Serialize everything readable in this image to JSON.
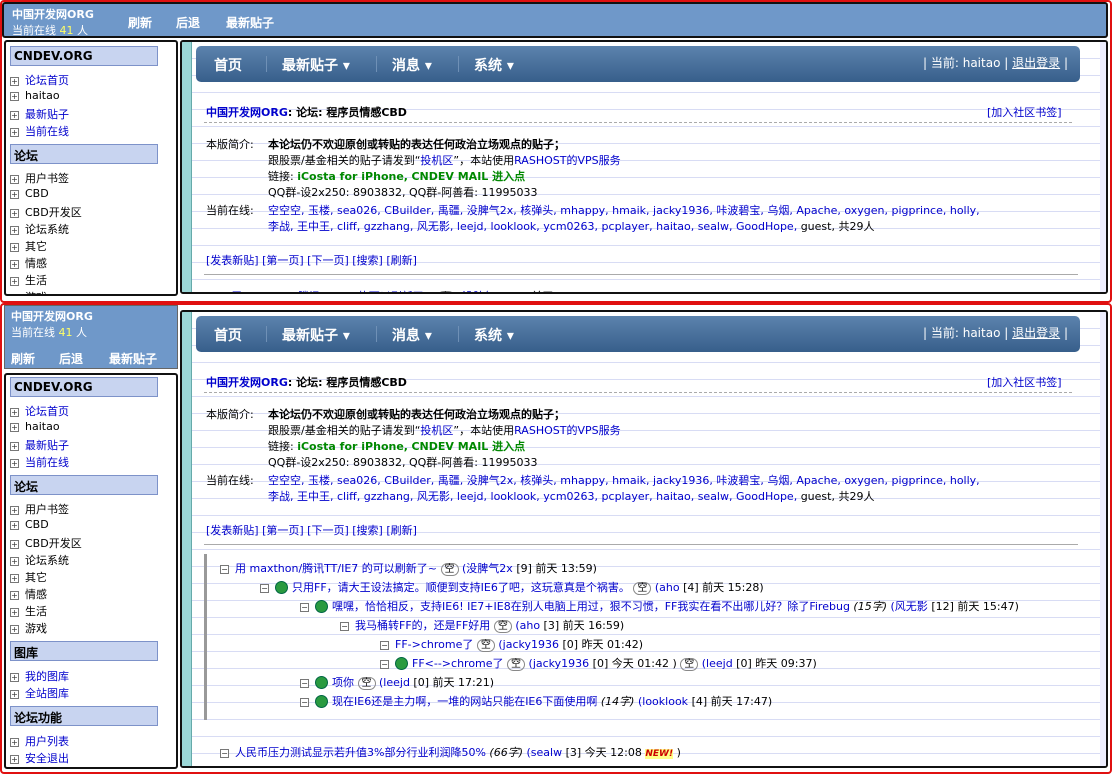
{
  "header": {
    "site": "中国开发网ORG",
    "online_label": "当前在线",
    "online_count": "41",
    "online_unit": "人",
    "buttons": [
      "刷新",
      "后退",
      "最新贴子"
    ]
  },
  "sidebar": {
    "brand": "CNDEV.ORG",
    "top_items": [
      "论坛首页",
      "haitao",
      "最新贴子",
      "当前在线"
    ],
    "sections": [
      {
        "title": "论坛",
        "items": [
          "用户书签",
          "CBD",
          "CBD开发区",
          "论坛系统",
          "其它",
          "情感",
          "生活",
          "游戏"
        ]
      },
      {
        "title": "图库",
        "items": [
          "我的图库",
          "全站图库"
        ]
      },
      {
        "title": "论坛功能",
        "items": [
          "用户列表",
          "安全退出"
        ]
      }
    ]
  },
  "nav": {
    "items": [
      "首页",
      "最新贴子 ▾",
      "消息 ▾",
      "系统 ▾"
    ],
    "current_label": "| 当前: haitao |",
    "logout": "退出登录",
    "end_sep": "|"
  },
  "forum": {
    "site": "中国开发网ORG",
    "crumb_rest": ": 论坛: 程序员情感CBD",
    "bookmark": "[加入社区书签]",
    "intro_label": "本版简介:",
    "intro_line1": "本论坛仍不欢迎原创或转贴的表达任何政治立场观点的贴子；",
    "intro_line2_a": "跟股票/基金相关的贴子请发到“",
    "intro_line2_link": "投机区",
    "intro_line2_b": "”，本站使用",
    "intro_line2_link2": "RASHOST的VPS服务",
    "links_label": "链接:",
    "link1": "iCosta for iPhone,",
    "link2": "CNDEV MAIL 进入点",
    "qq_line": "QQ群-设2x250: 8903832, QQ群-阿善看: 11995033",
    "online_label": "当前在线:",
    "online_users_1": "空空空, 玉楼, sea026, CBuilder, 禹疆, 没脾气2x, 核弹头, mhappy, hmaik, jacky1936, 咔波碧宝, 乌烟, Apache, oxygen, pigprince, holly,",
    "online_users_2": "李战, 王中王, cliff, gzzhang, 风无影, leejd, looklook, ycm0263, pcplayer, haitao, sealw, GoodHope,",
    "guest_total": "guest, 共29人",
    "actions": "[发表新贴] [第一页] [下一页] [搜索] [刷新]"
  },
  "threads": [
    {
      "title": "用 maxthon/腾讯TT/IE7 的可以刷新了~",
      "tag": "空",
      "author": "(没脾气2x",
      "meta": "[9] 前天 13:59)"
    },
    {
      "title": "只用FF，请大王设法搞定。顺便到支持IE6了吧，这玩意真是个祸害。",
      "tag": "空",
      "author": "(aho",
      "meta": "[4] 前天 15:28)"
    },
    {
      "title": "嘿嘿，恰恰相反，支持IE6! IE7+IE8在别人电脑上用过，狠不习惯，FF我实在看不出哪儿好？除了Firebug",
      "size": "(15字)",
      "author": "(风无影",
      "meta": "[12] 前天 15:47)"
    },
    {
      "title": "我马桶转FF的，还是FF好用",
      "tag": "空",
      "author": "(aho",
      "meta": "[3] 前天 16:59)"
    },
    {
      "title": "FF->chrome了",
      "tag": "空",
      "author": "(jacky1936",
      "meta": "[0] 昨天 01:42)"
    },
    {
      "title": "FF<-->chrome了",
      "tag": "空",
      "author": "(jacky1936",
      "meta": "[0] 今天 01:42 )"
    },
    {
      "title2_tag": "空",
      "author2": "(leejd",
      "meta2": "[0] 昨天 09:37)"
    },
    {
      "title": "项你",
      "tag": "空",
      "author": "(leejd",
      "meta": "[0] 前天 17:21)"
    },
    {
      "title": "现在IE6还是主力啊，一堆的网站只能在IE6下面使用啊",
      "size": "(14字)",
      "author": "(looklook",
      "meta": "[4] 前天 17:47)"
    },
    {
      "title": "人民币压力测试显示若升值3%部分行业利润降50%",
      "size": "(66字)",
      "author": "(sealw",
      "meta": "[3] 今天 12:08",
      "new": "NEW!",
      "end": ")"
    }
  ]
}
